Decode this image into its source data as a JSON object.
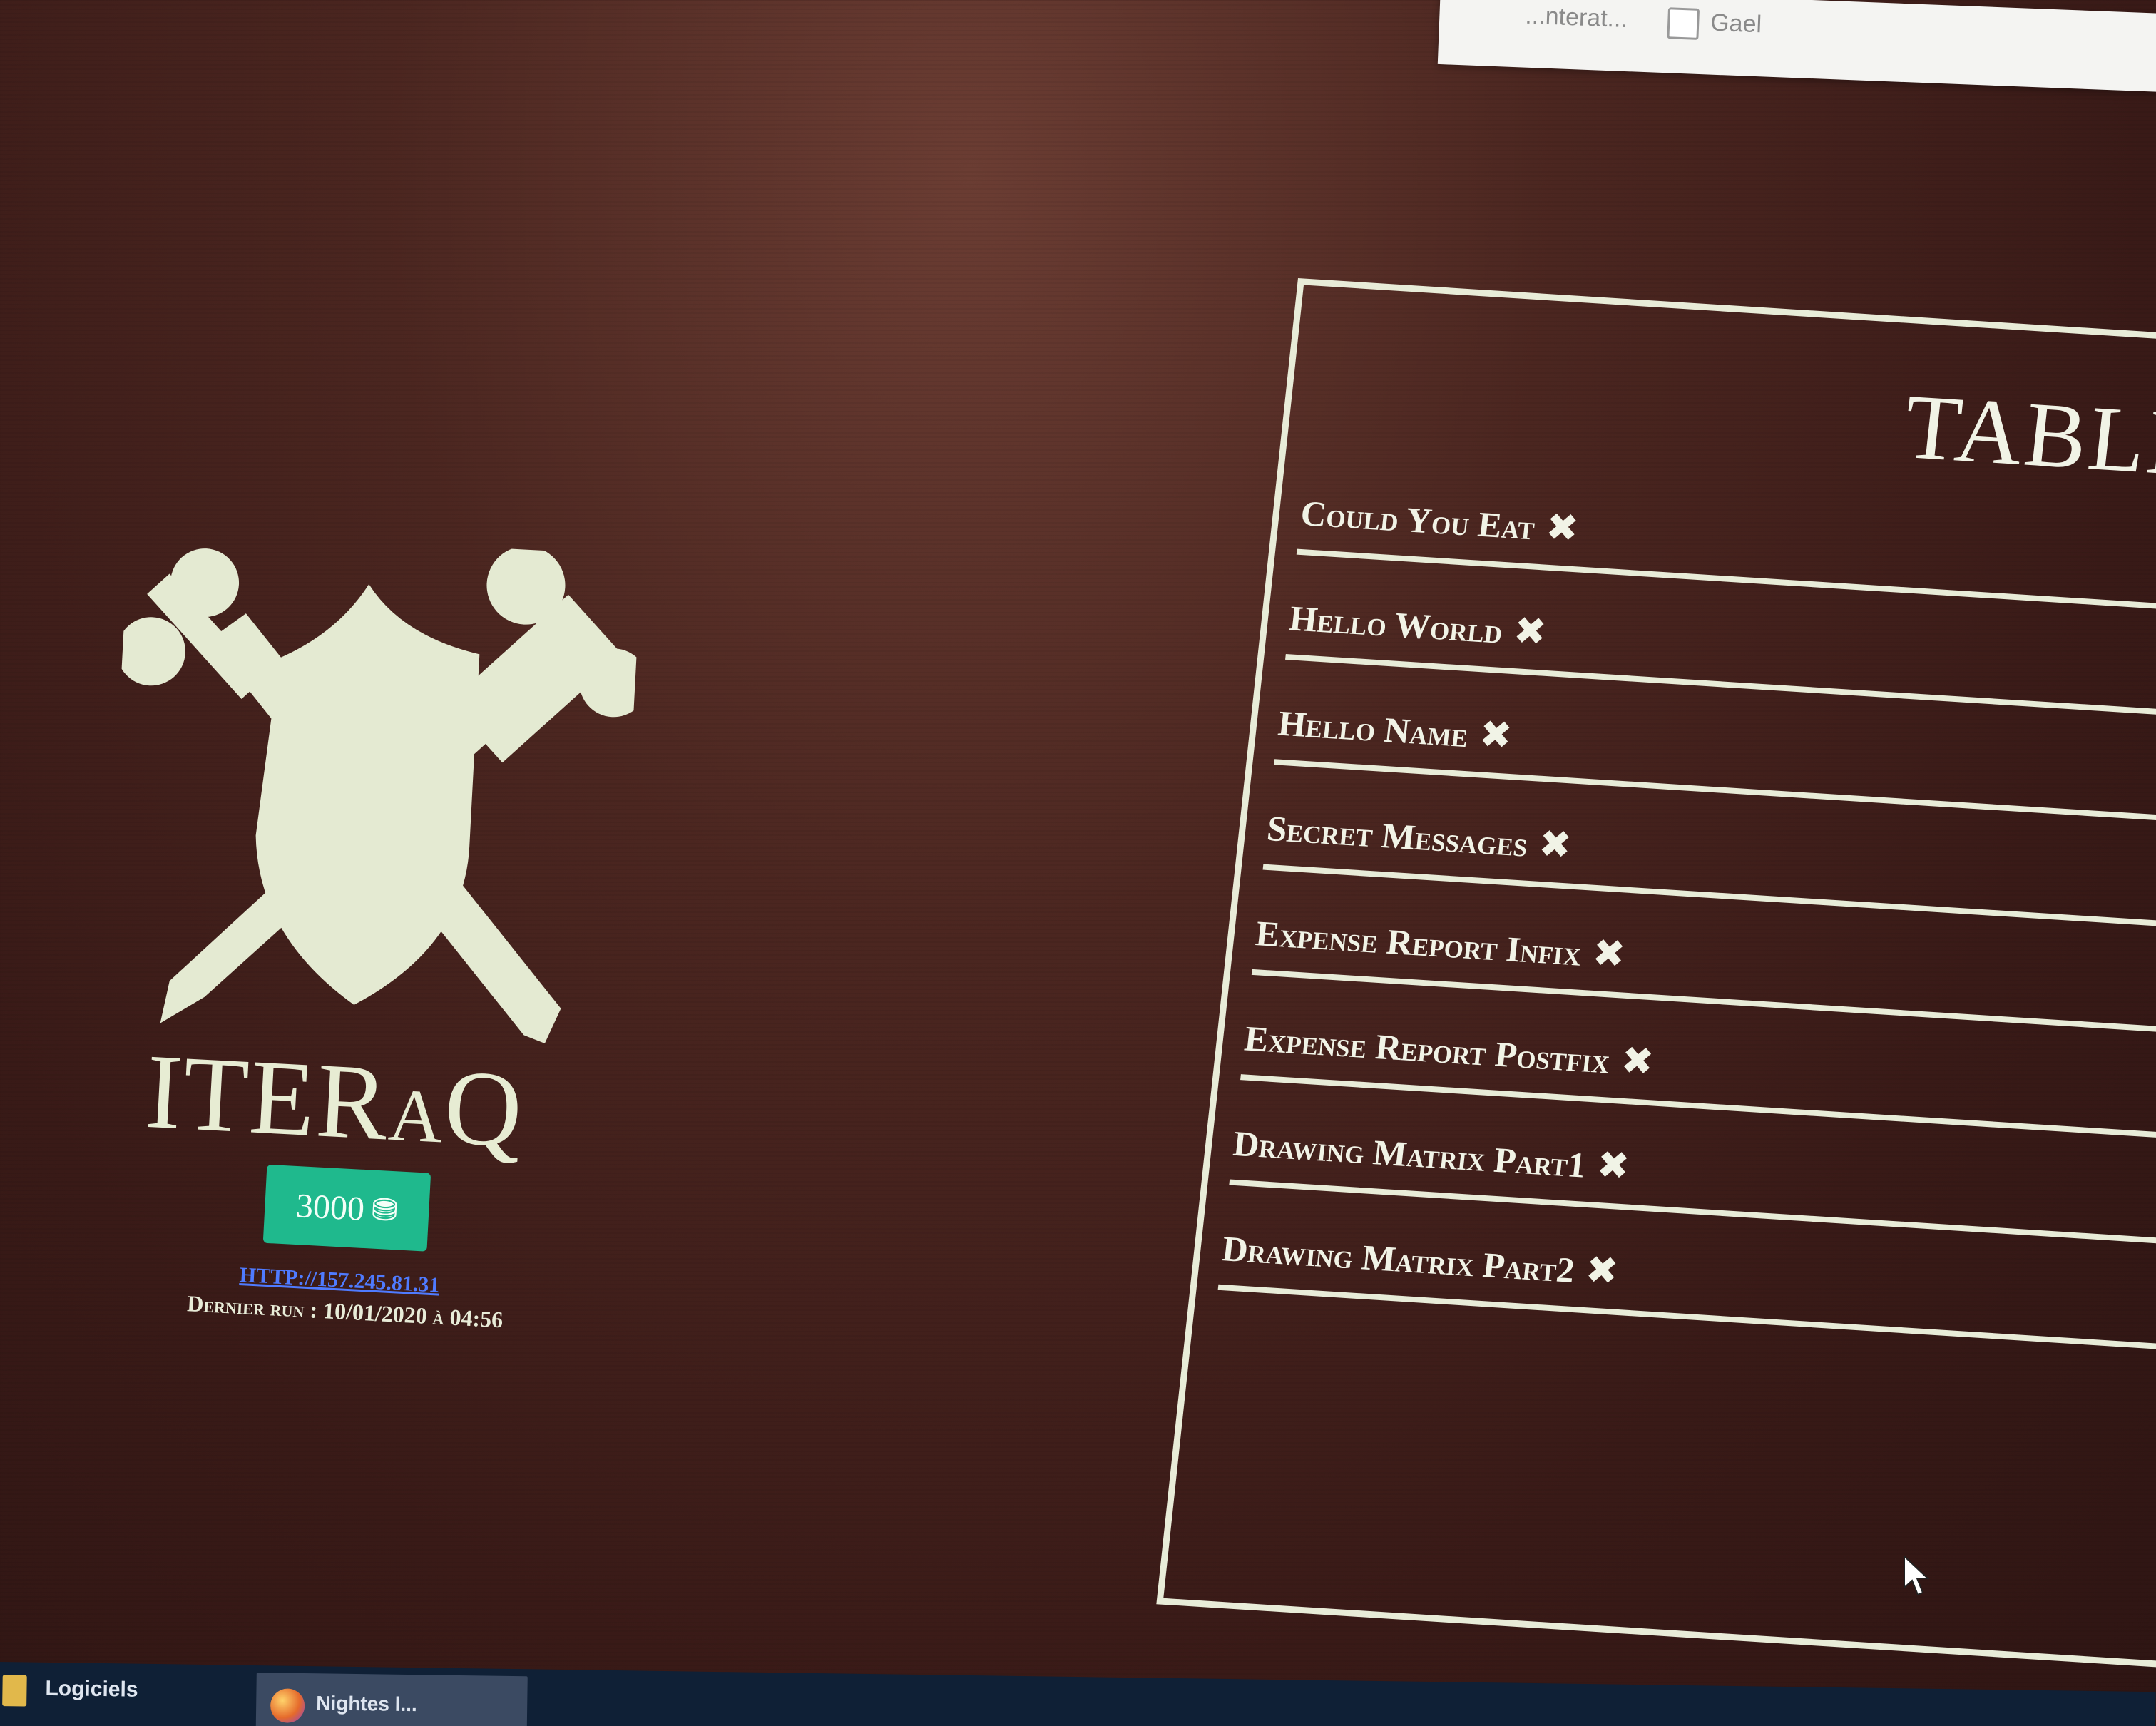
{
  "background_window": {
    "text_left": "...nterat...",
    "text_right": "Gael"
  },
  "brand": {
    "title": "ITERαQ",
    "coins": "3000",
    "coins_icon": "coins-stack-icon",
    "server_link": "HTTP://157.245.81.31",
    "last_run": "Dernier run : 10/01/2020 à 04:56"
  },
  "panel": {
    "title": "TABLEA",
    "tasks": [
      {
        "name": "Could You Eat",
        "status": "✖"
      },
      {
        "name": "Hello World",
        "status": "✖"
      },
      {
        "name": "Hello Name",
        "status": "✖"
      },
      {
        "name": "Secret Messages",
        "status": "✖"
      },
      {
        "name": "Expense Report Infix",
        "status": "✖"
      },
      {
        "name": "Expense Report Postfix",
        "status": "✖"
      },
      {
        "name": "Drawing Matrix Part1",
        "status": "✖"
      },
      {
        "name": "Drawing Matrix Part2",
        "status": "✖"
      }
    ]
  },
  "taskbar": {
    "folder_label": "Logiciels",
    "app_label": "Nightes l..."
  },
  "colors": {
    "background": "#4b2620",
    "foreground": "#e8ecd8",
    "accent_green": "#1fb98d",
    "link_blue": "#4f7bff"
  }
}
